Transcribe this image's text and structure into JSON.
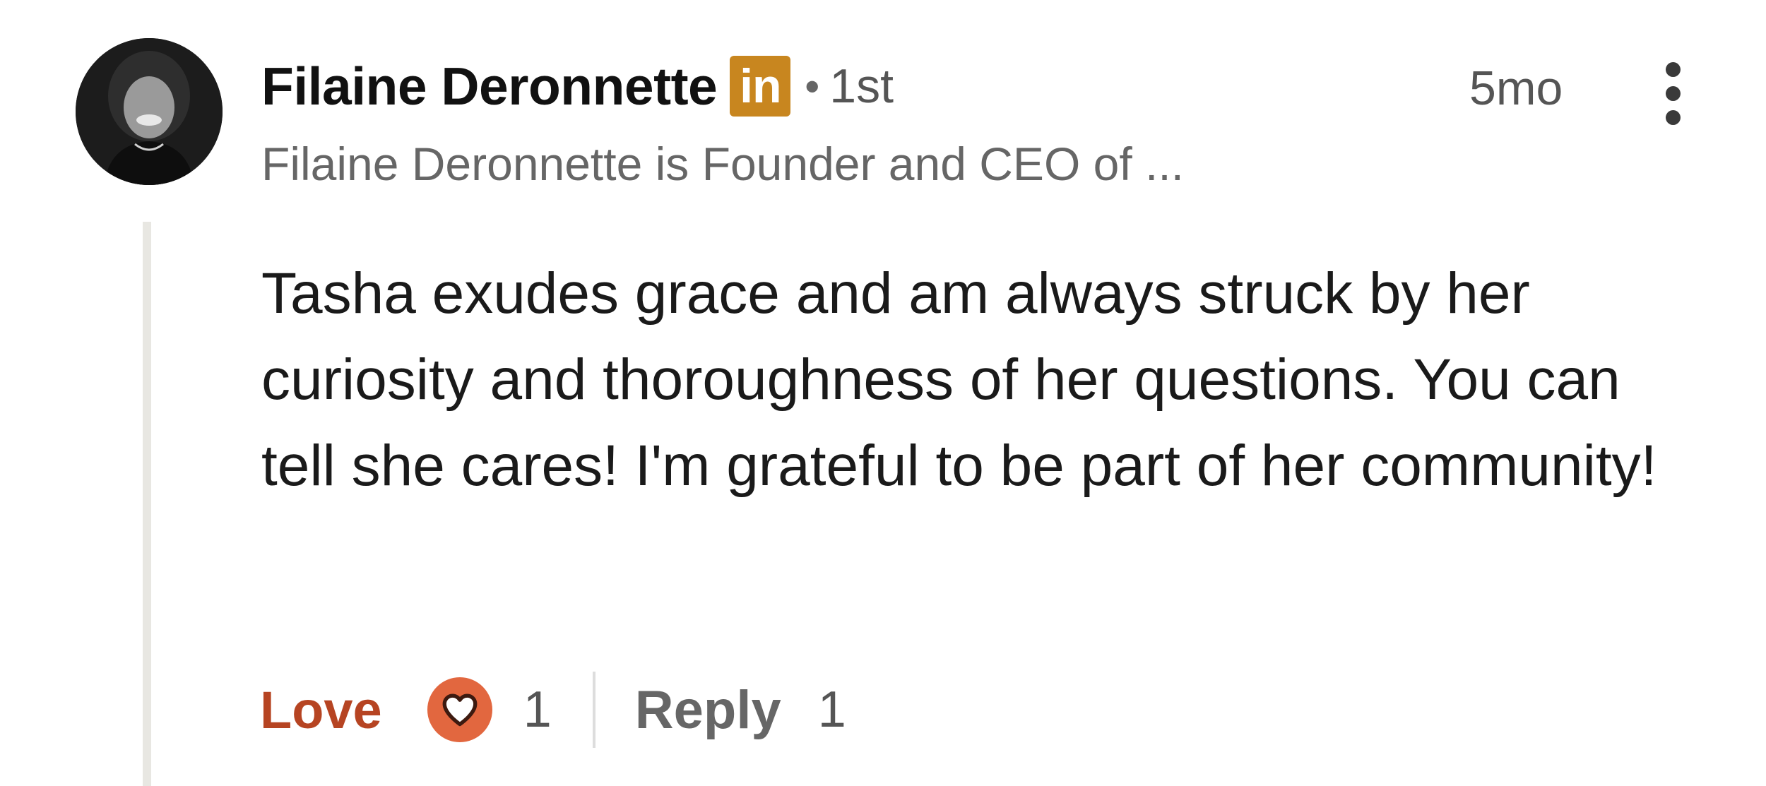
{
  "author": {
    "name": "Filaine Deronnette",
    "badge": "in",
    "degree_separator": "•",
    "degree": "1st",
    "headline": "Filaine Deronnette is Founder and CEO of ...",
    "avatar_icon": "profile-photo"
  },
  "timestamp": "5mo",
  "more_icon": "more-vertical-icon",
  "comment": {
    "text": "Tasha exudes grace and am always struck by her curiosity and thoroughness of her questions. You can tell she cares! I'm grateful to be part of her community!"
  },
  "actions": {
    "love_label": "Love",
    "reaction_icon": "heart-icon",
    "reaction_count": "1",
    "reply_label": "Reply",
    "reply_count": "1"
  },
  "colors": {
    "love": "#b64422",
    "heart_badge": "#e2673f",
    "linkedin_badge": "#c8861f",
    "thread_line": "#e8e7e2"
  }
}
